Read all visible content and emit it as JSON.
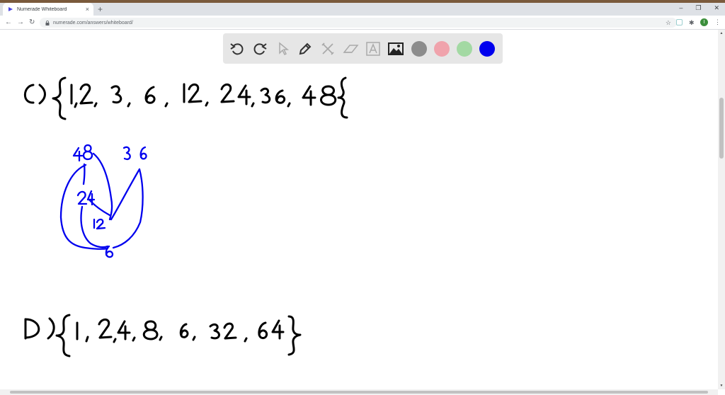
{
  "browser": {
    "tab_title": "Numerade Whiteboard",
    "new_tab_symbol": "+",
    "close_symbol": "×",
    "url": "numerade.com/answers/whiteboard/",
    "avatar_letter": "I"
  },
  "whiteboard": {
    "tools": [
      "undo-icon",
      "redo-icon",
      "select-icon",
      "pen-icon",
      "tools-icon",
      "eraser-icon",
      "text-icon",
      "image-icon"
    ],
    "colors": [
      "#8c8c8c",
      "#f0a3ac",
      "#a3d9a3",
      "#0000ee"
    ],
    "ink_color": "#0000ee"
  },
  "handwriting": {
    "line_c": {
      "label": "C)",
      "set_elements": [
        "1",
        "2",
        "3",
        "6",
        "12",
        "24",
        "36",
        "48"
      ]
    },
    "diagram_nodes": [
      "48",
      "36",
      "24",
      "12",
      "6"
    ],
    "line_d": {
      "label": "D)",
      "set_elements": [
        "1",
        "2",
        "4",
        "8",
        "6",
        "32",
        "64"
      ]
    }
  }
}
